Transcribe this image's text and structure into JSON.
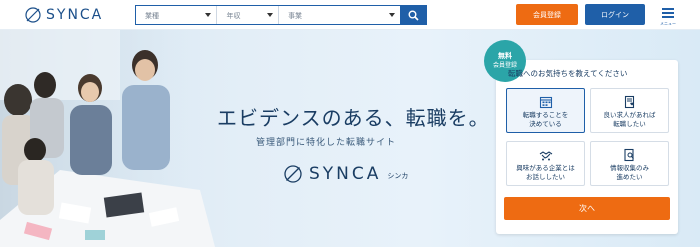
{
  "brand": {
    "name": "SYNCA",
    "kana": "シンカ"
  },
  "search": {
    "select1": "業種",
    "select2": "年収",
    "select3": "事業",
    "search_icon": "search-icon"
  },
  "header": {
    "register_label": "会員登録",
    "login_label": "ログイン",
    "menu_label": "メニュー"
  },
  "hero": {
    "headline": "エビデンスのある、転職を。",
    "subline": "管理部門に特化した転職サイト"
  },
  "card": {
    "badge_line1": "無料",
    "badge_line2": "会員登録",
    "title": "転職へのお気持ちを教えてください",
    "options": [
      {
        "label": "転職することを\n決めている",
        "icon": "calendar-icon",
        "selected": true
      },
      {
        "label": "良い求人があれば\n転職したい",
        "icon": "document-heart-icon",
        "selected": false
      },
      {
        "label": "興味がある企業とは\nお話ししたい",
        "icon": "handshake-icon",
        "selected": false
      },
      {
        "label": "情報収集のみ\n進めたい",
        "icon": "document-search-icon",
        "selected": false
      }
    ],
    "next_label": "次へ"
  },
  "colors": {
    "primary": "#1f5fa8",
    "accent": "#ee6b12",
    "badge": "#2ba5a8",
    "heading": "#1a3d63"
  }
}
